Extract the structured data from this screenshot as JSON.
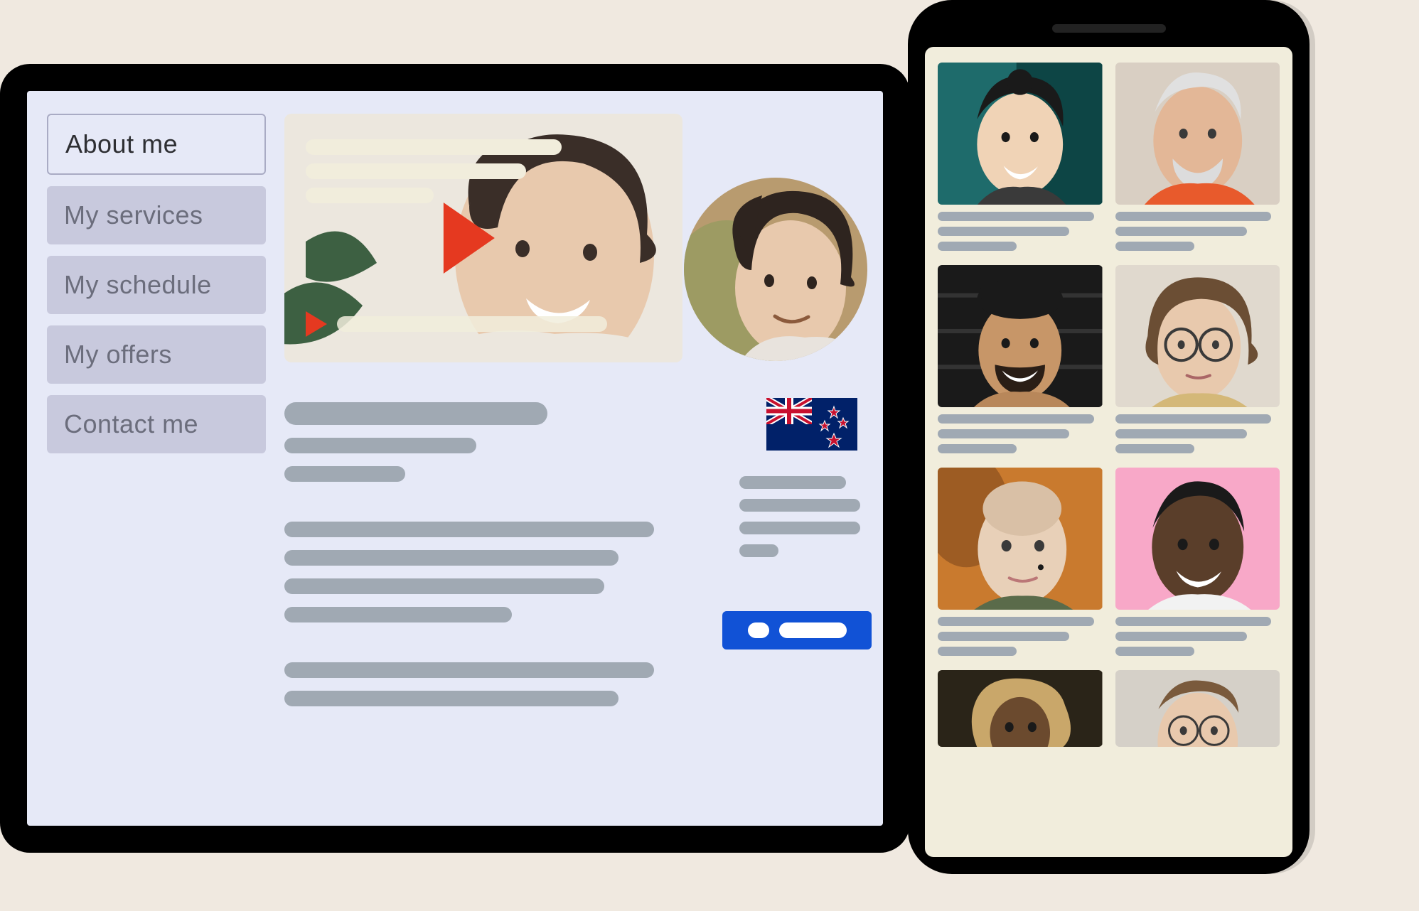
{
  "tablet": {
    "nav": [
      {
        "label": "About me",
        "active": true
      },
      {
        "label": "My services",
        "active": false
      },
      {
        "label": "My schedule",
        "active": false
      },
      {
        "label": "My offers",
        "active": false
      },
      {
        "label": "Contact me",
        "active": false
      }
    ],
    "profile": {
      "flag": "new-zealand"
    }
  },
  "phone": {
    "cards": [
      {},
      {},
      {},
      {},
      {},
      {},
      {},
      {}
    ]
  },
  "colors": {
    "accent": "#1152d6",
    "play": "#e53920"
  }
}
